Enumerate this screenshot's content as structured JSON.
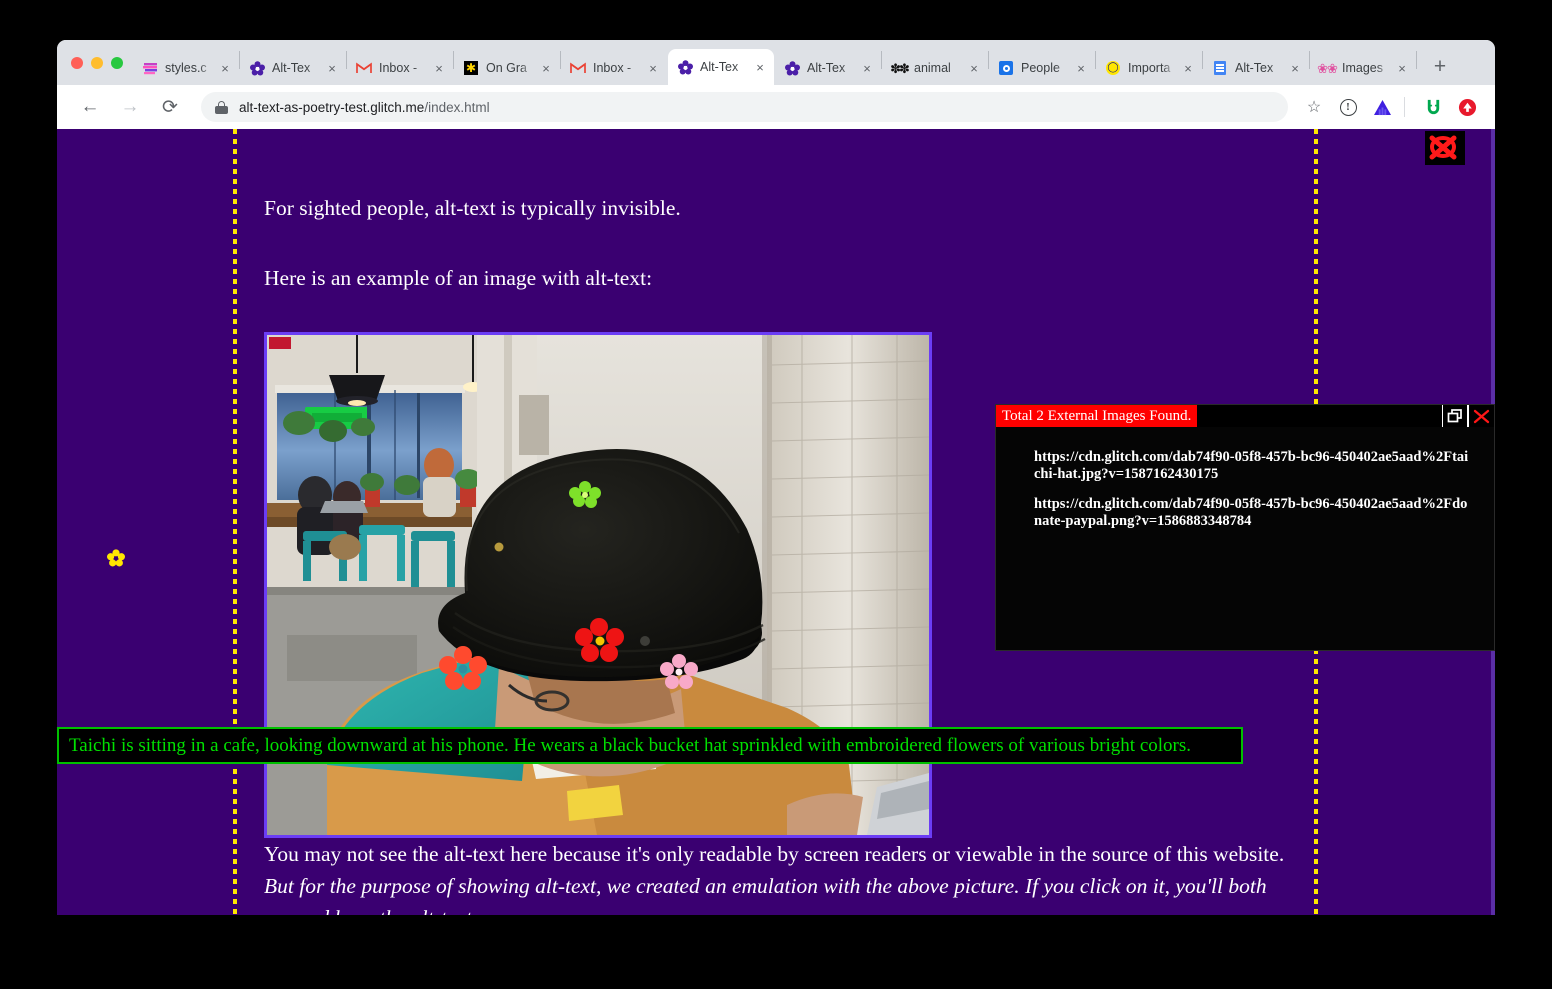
{
  "window": {
    "traffic_lights": [
      "close",
      "minimize",
      "zoom"
    ]
  },
  "tabs": [
    {
      "title": "styles.c",
      "icon": "styles-icon",
      "active": false,
      "close_label": "×"
    },
    {
      "title": "Alt-Tex",
      "icon": "flower-purple-icon",
      "active": false,
      "close_label": "×"
    },
    {
      "title": "Inbox -",
      "icon": "gmail-icon",
      "active": false,
      "close_label": "×"
    },
    {
      "title": "On Gra",
      "icon": "on-grant-icon",
      "active": false,
      "close_label": "×"
    },
    {
      "title": "Inbox -",
      "icon": "gmail-icon",
      "active": false,
      "close_label": "×"
    },
    {
      "title": "Alt-Tex",
      "icon": "flower-purple-icon",
      "active": true,
      "close_label": "×"
    },
    {
      "title": "Alt-Tex",
      "icon": "flower-purple-icon",
      "active": false,
      "close_label": "×"
    },
    {
      "title": "animal",
      "icon": "animal-icon",
      "active": false,
      "close_label": "×"
    },
    {
      "title": "People",
      "icon": "people-icon",
      "active": false,
      "close_label": "×"
    },
    {
      "title": "Importa",
      "icon": "importa-icon",
      "active": false,
      "close_label": "×"
    },
    {
      "title": "Alt-Tex",
      "icon": "docs-icon",
      "active": false,
      "close_label": "×"
    },
    {
      "title": "Images",
      "icon": "images-icon",
      "active": false,
      "close_label": "×"
    }
  ],
  "new_tab_label": "+",
  "toolbar": {
    "back_label": "←",
    "forward_label": "→",
    "reload_label": "⟳",
    "url_host": "alt-text-as-poetry-test.glitch.me",
    "url_path": "/index.html",
    "bookmark_label": "☆",
    "info_label": "!",
    "extensions": [
      "triangle-extension-icon",
      "green-u-extension-icon",
      "red-arrow-extension-icon"
    ]
  },
  "page": {
    "background_color": "#3a0071",
    "paragraphs": {
      "p1": "For sighted people, alt-text is typically invisible.",
      "p2": "Here is an example of an image with alt-text:",
      "p3_plain": "You may not see the alt-text here because it's only readable by screen readers or viewable in the source of this website. ",
      "p3_italic": "But for the purpose of showing alt-text, we created an emulation with the above picture. If you click on it, you'll both see and hear the alt-text."
    },
    "image": {
      "alt": "Taichi is sitting in a cafe, looking downward at his phone. He wears a black bucket hat sprinkled with embroidered flowers of various bright colors.",
      "border_color": "#6b3df5"
    },
    "alt_caption": {
      "text": "Taichi is sitting in a cafe, looking downward at his phone. He wears a black bucket hat sprinkled with embroidered flowers of various bright colors.",
      "text_color": "#00e000",
      "background_color": "#000000"
    },
    "decorations": {
      "flower_color": "#ffe600",
      "dotted_line_color": "#ffe600"
    }
  },
  "ext_dialog": {
    "title": "Total 2 External Images Found.",
    "title_bg": "#ff0000",
    "restore_label": "restore",
    "close_label": "close",
    "urls": [
      "https://cdn.glitch.com/dab74f90-05f8-457b-bc96-450402ae5aad%2Ftaichi-hat.jpg?v=1587162430175",
      "https://cdn.glitch.com/dab74f90-05f8-457b-bc96-450402ae5aad%2Fdonate-paypal.png?v=1586883348784"
    ]
  }
}
